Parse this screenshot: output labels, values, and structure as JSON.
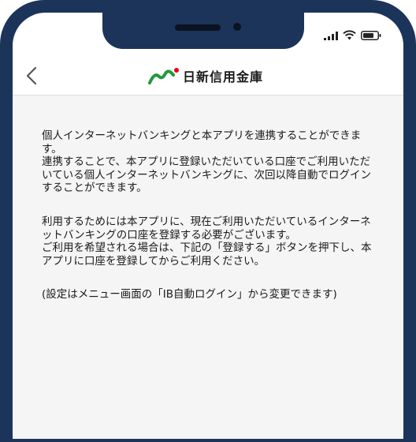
{
  "header": {
    "logo_text": "日新信用金庫"
  },
  "body": {
    "paragraph1": "個人インターネットバンキングと本アプリを連携することができます。\n連携することで、本アプリに登録いただいている口座でご利用いただいている個人インターネットバンキングに、次回以降自動でログインすることができます。",
    "paragraph2": "利用するためには本アプリに、現在ご利用いただいているインターネットバンキングの口座を登録する必要がございます。\nご利用を希望される場合は、下記の「登録する」ボタンを押下し、本アプリに口座を登録してからご利用ください。",
    "paragraph3": "(設定はメニュー画面の「IB自動ログイン」から変更できます)"
  },
  "icons": {
    "back": "chevron-left-icon",
    "signal": "cellular-signal-icon",
    "wifi": "wifi-icon",
    "battery": "battery-icon",
    "logo": "shinkin-logo-icon"
  },
  "colors": {
    "frame": "#1c3459",
    "logo_green": "#1f9a3c",
    "logo_red": "#e60012",
    "content_bg": "#f5f5f5"
  }
}
